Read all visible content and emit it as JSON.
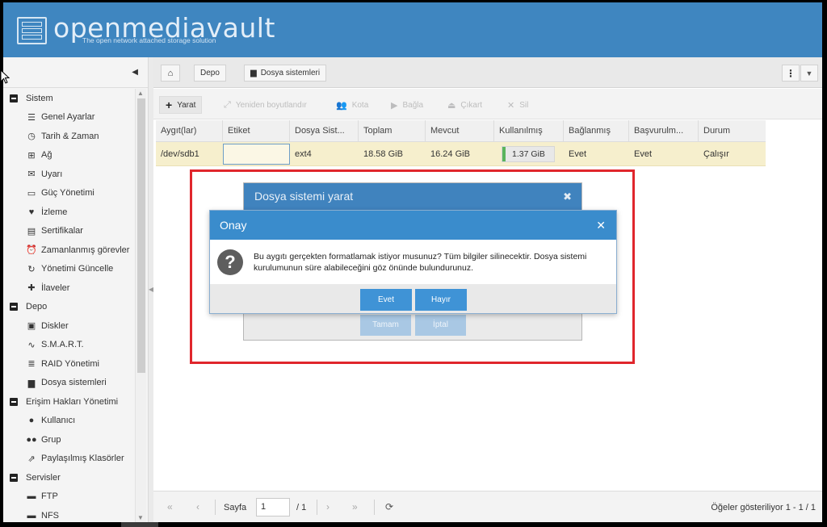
{
  "app": {
    "logo_title": "openmediavault",
    "logo_subtitle": "The open network attached storage solution"
  },
  "sidebar": {
    "collapse_icon": "chevron-left-icon",
    "groups": [
      {
        "label": "Sistem",
        "items": [
          {
            "label": "Genel Ayarlar",
            "icon": "sliders-icon"
          },
          {
            "label": "Tarih & Zaman",
            "icon": "clock-icon"
          },
          {
            "label": "Ağ",
            "icon": "network-icon"
          },
          {
            "label": "Uyarı",
            "icon": "envelope-icon"
          },
          {
            "label": "Güç Yönetimi",
            "icon": "battery-icon"
          },
          {
            "label": "İzleme",
            "icon": "heartbeat-icon"
          },
          {
            "label": "Sertifikalar",
            "icon": "certificate-icon"
          },
          {
            "label": "Zamanlanmış görevler",
            "icon": "alarm-clock-icon"
          },
          {
            "label": "Yönetimi Güncelle",
            "icon": "refresh-icon"
          },
          {
            "label": "İlaveler",
            "icon": "puzzle-icon"
          }
        ]
      },
      {
        "label": "Depo",
        "items": [
          {
            "label": "Diskler",
            "icon": "disk-icon"
          },
          {
            "label": "S.M.A.R.T.",
            "icon": "pulse-icon"
          },
          {
            "label": "RAID Yönetimi",
            "icon": "database-icon"
          },
          {
            "label": "Dosya sistemleri",
            "icon": "folder-icon"
          }
        ]
      },
      {
        "label": "Erişim Hakları Yönetimi",
        "items": [
          {
            "label": "Kullanıcı",
            "icon": "user-icon"
          },
          {
            "label": "Grup",
            "icon": "users-icon"
          },
          {
            "label": "Paylaşılmış Klasörler",
            "icon": "share-icon"
          }
        ]
      },
      {
        "label": "Servisler",
        "items": [
          {
            "label": "FTP",
            "icon": "ftp-icon"
          },
          {
            "label": "NFS",
            "icon": "nfs-icon"
          }
        ]
      }
    ]
  },
  "breadcrumb": {
    "home_icon": "home-icon",
    "items": [
      "Depo",
      "Dosya sistemleri"
    ]
  },
  "toolbar": {
    "create": "Yarat",
    "resize": "Yeniden boyutlandır",
    "quota": "Kota",
    "mount": "Bağla",
    "unmount": "Çıkart",
    "delete": "Sil"
  },
  "grid": {
    "columns": [
      "Aygıt(lar)",
      "Etiket",
      "Dosya Sist...",
      "Toplam",
      "Mevcut",
      "Kullanılmış",
      "Bağlanmış",
      "Başvurulm...",
      "Durum"
    ],
    "rows": [
      {
        "device": "/dev/sdb1",
        "label": "",
        "fs": "ext4",
        "total": "18.58 GiB",
        "available": "16.24 GiB",
        "used": "1.37 GiB",
        "used_fraction": 0.07,
        "mounted": "Evet",
        "referenced": "Evet",
        "status": "Çalışır"
      }
    ]
  },
  "pager": {
    "page_label": "Sayfa",
    "page_value": "1",
    "page_total": "/ 1",
    "info": "Öğeler gösteriliyor 1 - 1 / 1"
  },
  "dialog_back": {
    "title": "Dosya sistemi yarat",
    "ok": "Tamam",
    "cancel": "İptal"
  },
  "dialog_confirm": {
    "title": "Onay",
    "message": "Bu aygıtı gerçekten formatlamak istiyor musunuz? Tüm bilgiler silinecektir. Dosya sistemi kurulumunun süre alabileceğini göz önünde bulundurunuz.",
    "yes": "Evet",
    "no": "Hayır"
  },
  "colors": {
    "header": "#3f86c0",
    "dialog_title": "#3a8ccc",
    "button": "#3f93d6",
    "highlight_row": "#f6efcd",
    "annotation_box": "#e0262c"
  }
}
